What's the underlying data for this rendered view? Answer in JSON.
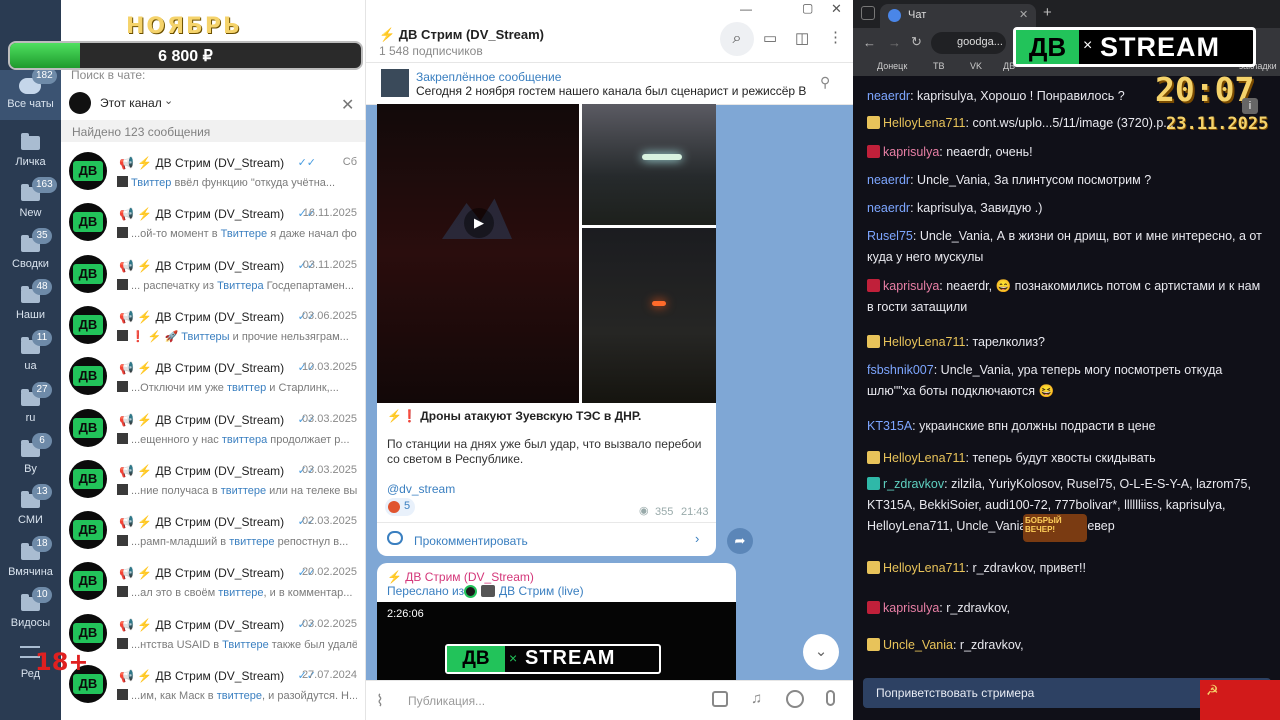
{
  "overlay": {
    "month": "НОЯБРЬ",
    "amount": "6 800 ₽",
    "progress": 0.2,
    "age_badge": "18+"
  },
  "rail": {
    "items": [
      {
        "label": "Все чаты",
        "badge": "182"
      },
      {
        "label": "Личка",
        "badge": ""
      },
      {
        "label": "New",
        "badge": "163"
      },
      {
        "label": "Сводки",
        "badge": "35"
      },
      {
        "label": "Наши",
        "badge": "48"
      },
      {
        "label": "ua",
        "badge": "11"
      },
      {
        "label": "ru",
        "badge": "27"
      },
      {
        "label": "By",
        "badge": "6"
      },
      {
        "label": "СМИ",
        "badge": "13"
      },
      {
        "label": "Вмячина",
        "badge": "18"
      },
      {
        "label": "Видосы",
        "badge": "10"
      },
      {
        "label": "Ред",
        "badge": ""
      }
    ]
  },
  "chatlist": {
    "search_placeholder": "Поиск в чате:",
    "scope": "Этот канал",
    "found": "Найдено 123 сообщения",
    "rows": [
      {
        "name": "📢 ⚡ ДВ Стрим (DV_Stream)",
        "date": "Сб",
        "pre": "",
        "hl": "Твиттер",
        "post": " ввёл функцию \"откуда учётна..."
      },
      {
        "name": "📢 ⚡ ДВ Стрим (DV_Stream)",
        "date": "16.11.2025",
        "pre": "...ой-то момент в ",
        "hl": "Твиттере",
        "post": " я даже начал фор..."
      },
      {
        "name": "📢 ⚡ ДВ Стрим (DV_Stream)",
        "date": "03.11.2025",
        "pre": "... распечатку из ",
        "hl": "Твиттера",
        "post": " Госдепартамен..."
      },
      {
        "name": "📢 ⚡ ДВ Стрим (DV_Stream)",
        "date": "03.06.2025",
        "pre": "❗ ⚡ 🚀 ",
        "hl": "Твиттеры",
        "post": " и прочие нельзяграм..."
      },
      {
        "name": "📢 ⚡ ДВ Стрим (DV_Stream)",
        "date": "10.03.2025",
        "pre": "...Отключи им уже ",
        "hl": "твиттер",
        "post": " и Старлинк,..."
      },
      {
        "name": "📢 ⚡ ДВ Стрим (DV_Stream)",
        "date": "03.03.2025",
        "pre": "...ещенного у нас ",
        "hl": "твиттера",
        "post": " продолжает р..."
      },
      {
        "name": "📢 ⚡ ДВ Стрим (DV_Stream)",
        "date": "03.03.2025",
        "pre": "...ние получаса в ",
        "hl": "твиттере",
        "post": " или на телеке выс..."
      },
      {
        "name": "📢 ⚡ ДВ Стрим (DV_Stream)",
        "date": "02.03.2025",
        "pre": "...рамп-младший в ",
        "hl": "твиттере",
        "post": " репостнул в..."
      },
      {
        "name": "📢 ⚡ ДВ Стрим (DV_Stream)",
        "date": "20.02.2025",
        "pre": "...ал это в своём ",
        "hl": "твиттере",
        "post": ", и в комментар..."
      },
      {
        "name": "📢 ⚡ ДВ Стрим (DV_Stream)",
        "date": "03.02.2025",
        "pre": "...нтства USAID в ",
        "hl": "Твиттере",
        "post": " также был удалён..."
      },
      {
        "name": "📢 ⚡ ДВ Стрим (DV_Stream)",
        "date": "27.07.2024",
        "pre": "...им, как Маск в ",
        "hl": "твиттере",
        "post": ", и разойдутся. Н..."
      }
    ]
  },
  "channel": {
    "title": "⚡ ДВ Стрим (DV_Stream)",
    "subs": "1 548 подписчиков",
    "pinned_label": "Закреплённое сообщение",
    "pinned_text": "Сегодня 2 ноября гостем нашего канала был сценарист и режиссёр Вла...",
    "post_head": "⚡❗ Дроны атакуют Зуевскую ТЭС в ДНР.",
    "post_body": "По станции на днях уже был удар, что вызвало перебои со светом в Республике.",
    "post_link": "@dv_stream",
    "reaction_count": "5",
    "views": "355",
    "time": "21:43",
    "comment_label": "Прокомментировать",
    "fwd_author": "⚡ ДВ Стрим (DV_Stream)",
    "fwd_from_label": "Переслано из",
    "fwd_from_name": "ДВ Стрим (live)",
    "video_duration": "2:26:06",
    "compose_placeholder": "Публикация..."
  },
  "browser": {
    "tab_title": "Чат",
    "url": "goodga...",
    "bookmarks": [
      "Донецк",
      "ТВ",
      "VK",
      "ДВ"
    ],
    "bookmarks_more": "закладки",
    "clock": "20:07",
    "date": "23.11.2025",
    "logo_left": "ДВ",
    "logo_right": "STREAM",
    "greet_button": "Поприветствовать стримера",
    "chat": [
      {
        "user": "neaerdr",
        "cls": "blue",
        "text": "kaprisulya, Хорошо ! Понравилось ?"
      },
      {
        "user": "HelloyLena711",
        "cls": "gold",
        "text": "cont.ws/uplo...5/11/image (3720).p..."
      },
      {
        "user": "kaprisulya",
        "cls": "pink",
        "text": "neaerdr, очень!"
      },
      {
        "user": "neaerdr",
        "cls": "blue",
        "text": "Uncle_Vania, За плинтусом посмотрим ?"
      },
      {
        "user": "neaerdr",
        "cls": "blue",
        "text": "kaprisulya, Завидую .)"
      },
      {
        "user": "Rusel75",
        "cls": "blue",
        "text": "Uncle_Vania, А в жизни он дрищ, вот и мне интересно, а от куда у него мускулы"
      },
      {
        "user": "kaprisulya",
        "cls": "pink",
        "text": "neaerdr, 😄 познакомились потом с артистами и к нам в гости затащили"
      },
      {
        "user": "HelloyLena711",
        "cls": "gold",
        "text": "тарелколиз?"
      },
      {
        "user": "fsbshnik007",
        "cls": "blue",
        "text": "Uncle_Vania, ура теперь могу посмотреть откуда шлю\"\"ха боты подключаются 😆"
      },
      {
        "user": "KT315A",
        "cls": "blue",
        "text": "украинские впн должны подрасти в цене"
      },
      {
        "user": "HelloyLena711",
        "cls": "gold",
        "text": "теперь будут хвосты скидывать"
      },
      {
        "user": "r_zdravkov",
        "cls": "teal",
        "text": "zilzila, YuriyKolosov, Rusel75, O-L-E-S-Y-A, lazrom75, KT315A, BekkiSoier, audi100-72, 777bolivar*, lllllliiss, kaprisulya, HelloyLena711, Uncle_Vania, ВПН форевер"
      },
      {
        "user": "HelloyLena711",
        "cls": "gold",
        "text": "r_zdravkov, привет!!"
      },
      {
        "user": "kaprisulya",
        "cls": "pink",
        "text": "r_zdravkov,"
      },
      {
        "user": "Uncle_Vania",
        "cls": "gold",
        "text": "r_zdravkov,"
      }
    ],
    "sticker_text": "БОБРЫЙ ВЕЧЕР!"
  },
  "colors": {
    "tg_rail": "#2a3b52",
    "tg_accent": "#3a7fc0",
    "chat_bg": "#101018",
    "green": "#22c35a",
    "overlay_gold": "#f5d36b"
  }
}
